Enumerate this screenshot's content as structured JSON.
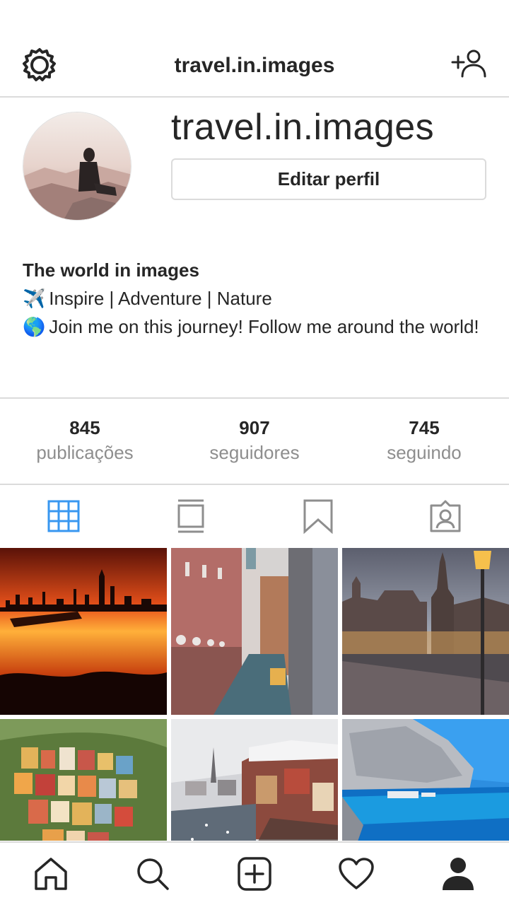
{
  "header": {
    "title": "travel.in.images",
    "settings_icon": "gear-icon",
    "add_user_icon": "add-user-icon"
  },
  "profile": {
    "username": "travel.in.images",
    "edit_button": "Editar perfil",
    "avatar": "profile-photo"
  },
  "bio": {
    "name": "The world in images",
    "lines": [
      {
        "emoji": "✈️",
        "text": "Inspire | Adventure | Nature"
      },
      {
        "emoji": "🌎",
        "text": "Join me on this journey! Follow me around the world!"
      }
    ]
  },
  "stats": [
    {
      "value": "845",
      "label": "publicações"
    },
    {
      "value": "907",
      "label": "seguidores"
    },
    {
      "value": "745",
      "label": "seguindo"
    }
  ],
  "tabs": [
    {
      "icon": "grid-icon",
      "active": true
    },
    {
      "icon": "feed-icon",
      "active": false
    },
    {
      "icon": "bookmark-icon",
      "active": false
    },
    {
      "icon": "tagged-icon",
      "active": false
    }
  ],
  "colors": {
    "accent": "#3897f0",
    "icon": "#262626",
    "inactive_icon": "#8e8e8e",
    "border": "#dbdbdb",
    "secondary_text": "#8e8e8e"
  },
  "posts": [
    {
      "subject": "city skyline at sunset"
    },
    {
      "subject": "venice canal"
    },
    {
      "subject": "european square at dusk"
    },
    {
      "subject": "colorful coastal village"
    },
    {
      "subject": "snowy lakeside village"
    },
    {
      "subject": "sea cliffs blue water"
    }
  ],
  "bottom_nav": [
    {
      "icon": "home-icon"
    },
    {
      "icon": "search-icon"
    },
    {
      "icon": "new-post-icon"
    },
    {
      "icon": "heart-icon"
    },
    {
      "icon": "profile-icon"
    }
  ]
}
